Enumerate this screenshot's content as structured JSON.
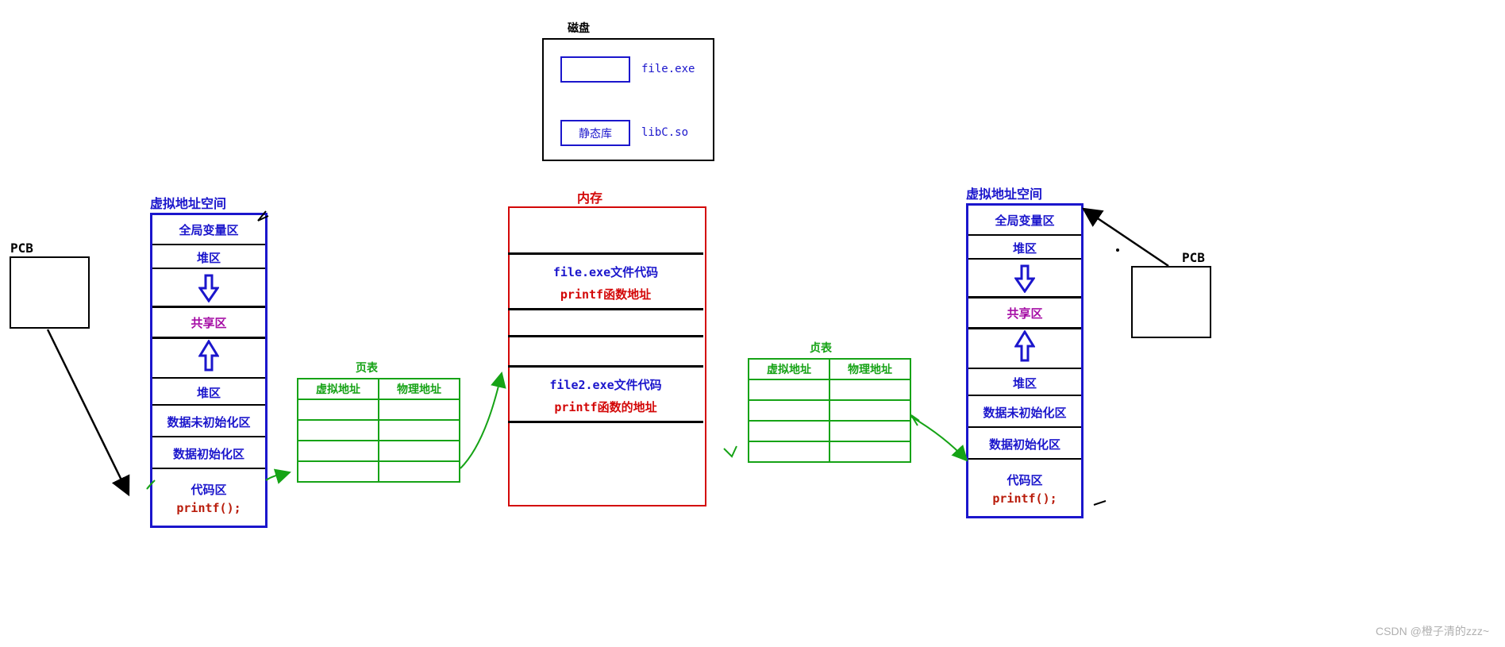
{
  "disk": {
    "title": "磁盘",
    "file_label": "file.exe",
    "lib_box_text": "静态库",
    "lib_label": "libC.so"
  },
  "memory": {
    "title": "内存",
    "block1_line1": "file.exe文件代码",
    "block1_line2": "printf函数地址",
    "block2_line1": "file2.exe文件代码",
    "block2_line2": "printf函数的地址"
  },
  "vas_left": {
    "title": "虚拟地址空间",
    "rows": {
      "globals": "全局变量区",
      "heap": "堆区",
      "shared": "共享区",
      "stack": "堆区",
      "bss": "数据未初始化区",
      "data": "数据初始化区",
      "code": "代码区",
      "printf": "printf();"
    }
  },
  "vas_right": {
    "title": "虚拟地址空间",
    "rows": {
      "globals": "全局变量区",
      "heap": "堆区",
      "shared": "共享区",
      "stack": "堆区",
      "bss": "数据未初始化区",
      "data": "数据初始化区",
      "code": "代码区",
      "printf": "printf();"
    }
  },
  "page_table_left": {
    "title": "页表",
    "col1": "虚拟地址",
    "col2": "物理地址"
  },
  "page_table_right": {
    "title": "贞表",
    "col1": "虚拟地址",
    "col2": "物理地址"
  },
  "pcb_left": {
    "label": "PCB"
  },
  "pcb_right": {
    "label": "PCB"
  },
  "watermark": "CSDN @橙子清的zzz~"
}
